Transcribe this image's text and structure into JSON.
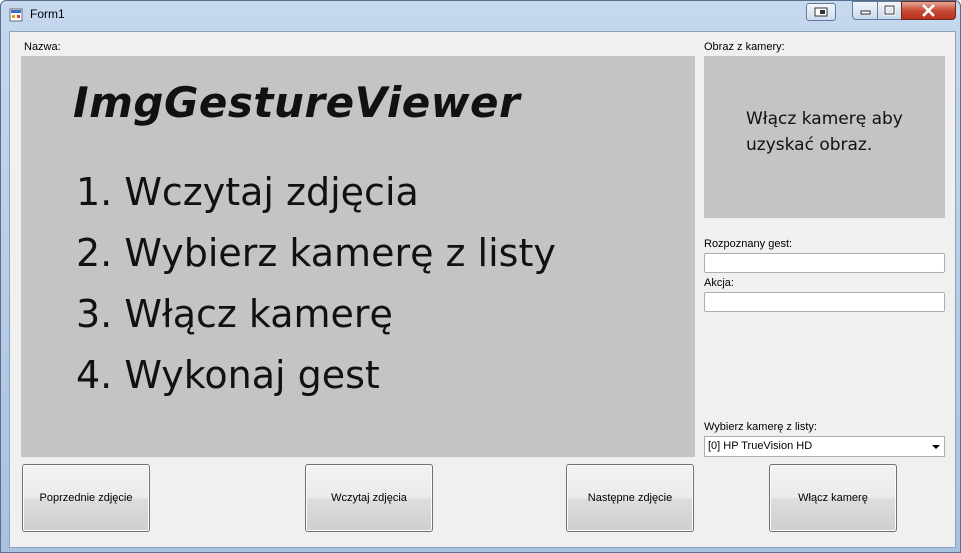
{
  "window": {
    "title": "Form1"
  },
  "labels": {
    "name": "Nazwa:",
    "camera_image": "Obraz z kamery:",
    "recognized_gesture": "Rozpoznany gest:",
    "action": "Akcja:",
    "choose_camera": "Wybierz kamerę z listy:"
  },
  "main_image": {
    "title": "ImgGestureViewer",
    "steps": [
      "1. Wczytaj zdjęcia",
      "2. Wybierz kamerę z listy",
      "3. Włącz kamerę",
      "4. Wykonaj gest"
    ]
  },
  "camera_panel": {
    "message": "Włącz kamerę aby uzyskać obraz."
  },
  "fields": {
    "recognized_gesture_value": "",
    "action_value": ""
  },
  "camera_select": {
    "selected": "[0] HP TrueVision HD"
  },
  "buttons": {
    "previous": "Poprzednie zdjęcie",
    "load": "Wczytaj zdjęcia",
    "next": "Następne zdjęcie",
    "camera_on": "Włącz kamerę"
  },
  "colors": {
    "panel_background": "#c4c4c4",
    "client_background": "#f0f0f0",
    "close_button": "#c84a35"
  },
  "icons": {
    "app": "form-app-icon",
    "minimize": "minimize-icon",
    "maximize": "maximize-icon",
    "close": "close-icon",
    "dropdown": "chevron-down-icon"
  }
}
